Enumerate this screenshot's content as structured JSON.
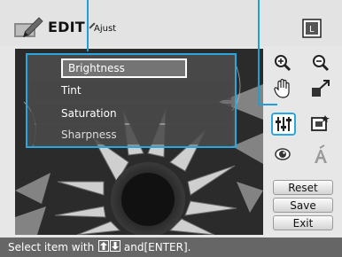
{
  "header": {
    "title": "EDIT",
    "subtitle": "Ajust",
    "icons": [
      "edit-pencil-icon",
      "layout-icon"
    ]
  },
  "menu": {
    "items": [
      {
        "label": "Brightness",
        "selected": true
      },
      {
        "label": "Tint",
        "selected": false
      },
      {
        "label": "Saturation",
        "selected": false
      },
      {
        "label": "Sharpness",
        "selected": false
      }
    ]
  },
  "tools": [
    "zoom-in-icon",
    "zoom-out-icon",
    "hand-pan-icon",
    "resize-icon",
    "adjust-sliders-icon",
    "frame-icon",
    "red-eye-icon",
    "sepia-icon"
  ],
  "buttons": {
    "reset": "Reset",
    "save": "Save",
    "exit": "Exit"
  },
  "status": {
    "prefix": "Select item with",
    "middle": "and",
    "key": "[ENTER]",
    "suffix": "."
  },
  "colors": {
    "accent": "#2aa7df",
    "status_bar": "#666666",
    "background": "#e7e7e7"
  }
}
